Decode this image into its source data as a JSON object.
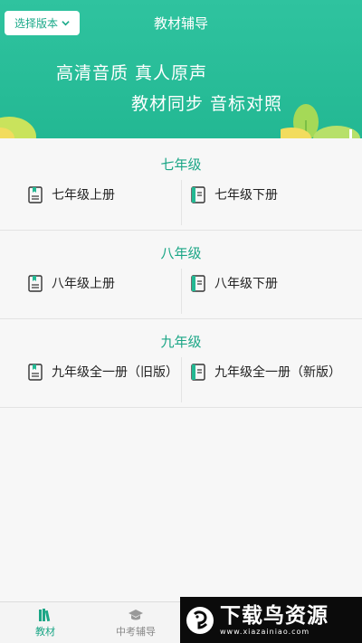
{
  "header": {
    "title": "教材辅导",
    "version_button": "选择版本",
    "slogan_line1": "高清音质  真人原声",
    "slogan_line2": "教材同步  音标对照",
    "colors": {
      "primary": "#23b893",
      "accent": "#1ba686"
    }
  },
  "grades": [
    {
      "title": "七年级",
      "books": [
        "七年级上册",
        "七年级下册"
      ]
    },
    {
      "title": "八年级",
      "books": [
        "八年级上册",
        "八年级下册"
      ]
    },
    {
      "title": "九年级",
      "books": [
        "九年级全一册（旧版）",
        "九年级全一册（新版）"
      ]
    }
  ],
  "tabs": [
    {
      "label": "教材",
      "icon": "books-icon",
      "active": true
    },
    {
      "label": "中考辅导",
      "icon": "graduation-cap-icon",
      "active": false
    }
  ],
  "watermark": {
    "title": "下载鸟资源",
    "site": "www.xiazainiao.com"
  }
}
